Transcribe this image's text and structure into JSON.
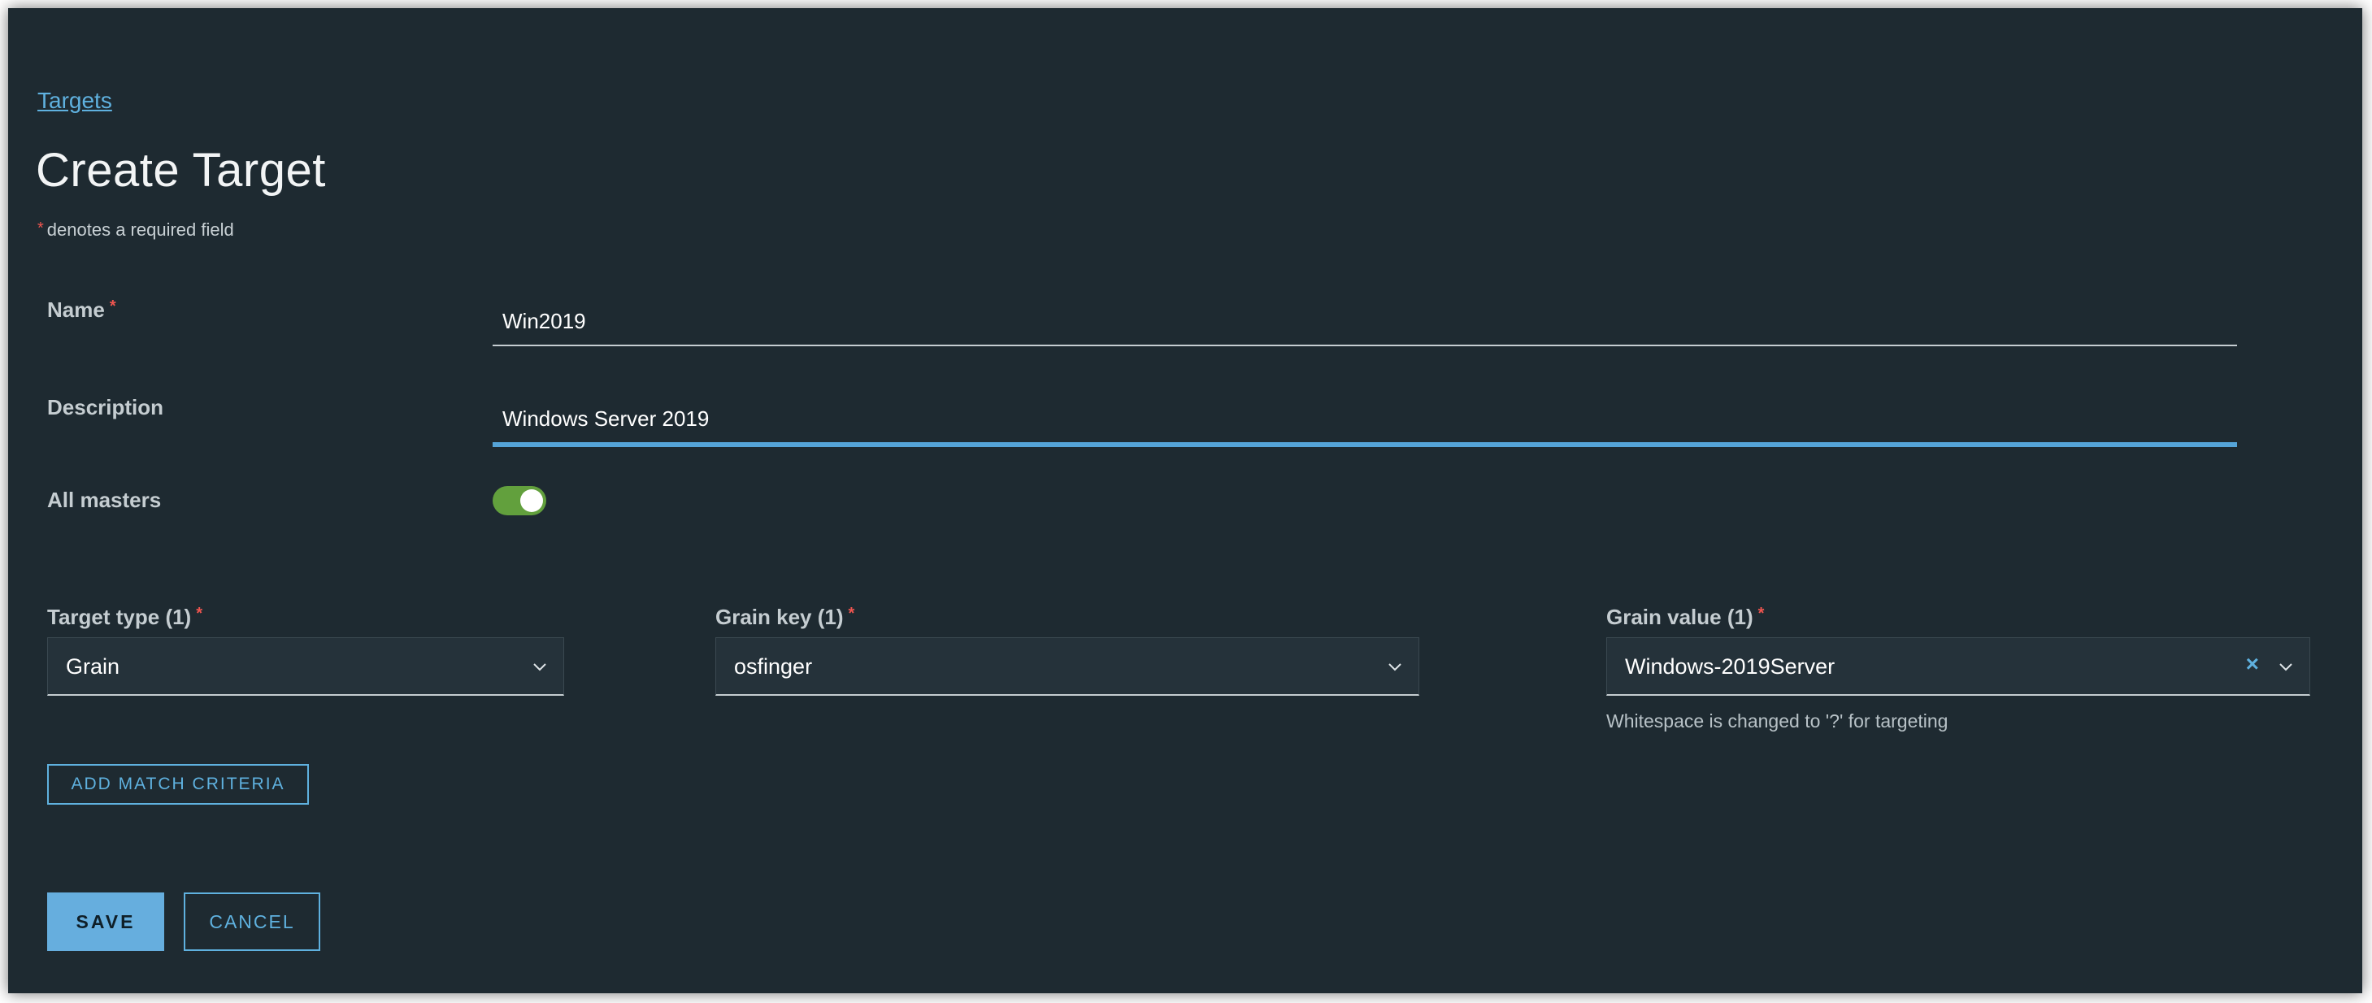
{
  "breadcrumb": "Targets",
  "title": "Create Target",
  "required_note": "denotes a required field",
  "required_mark": "*",
  "name": {
    "label": "Name",
    "value": "Win2019"
  },
  "description": {
    "label": "Description",
    "value": "Windows Server 2019"
  },
  "all_masters": {
    "label": "All masters",
    "on": true
  },
  "criteria": {
    "target_type": {
      "label": "Target type (1)",
      "value": "Grain"
    },
    "grain_key": {
      "label": "Grain key (1)",
      "value": "osfinger"
    },
    "grain_value": {
      "label": "Grain value (1)",
      "value": "Windows-2019Server",
      "hint": "Whitespace is changed to '?' for targeting"
    }
  },
  "add_match_label": "ADD MATCH CRITERIA",
  "save_label": "SAVE",
  "cancel_label": "CANCEL",
  "colors": {
    "accent": "#5fb1df",
    "toggle_on": "#62a03d",
    "required": "#f0554f",
    "background": "#1e2a31"
  }
}
